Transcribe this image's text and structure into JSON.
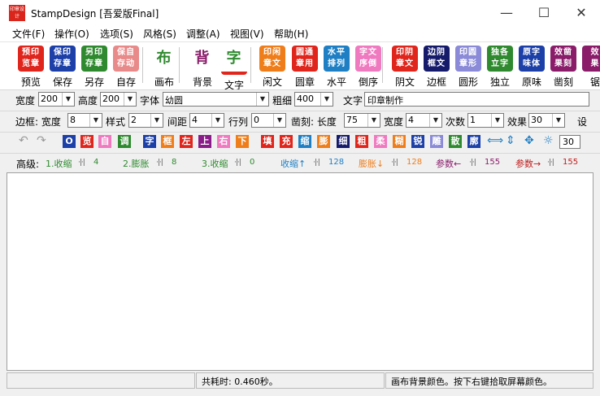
{
  "title": "StampDesign [吾爱版Final]",
  "app_icon_text": "印章设计",
  "window_controls": {
    "minimize": "—",
    "maximize": "☐",
    "close": "✕"
  },
  "menu": [
    "文件(F)",
    "操作(O)",
    "选项(S)",
    "风格(S)",
    "调整(A)",
    "视图(V)",
    "帮助(H)"
  ],
  "big_toolbar": [
    {
      "icon": [
        "预印",
        "览章"
      ],
      "label": "预览",
      "color": "#e0251c"
    },
    {
      "icon": [
        "保印",
        "存章"
      ],
      "label": "保存",
      "color": "#1c3fa8"
    },
    {
      "icon": [
        "另印",
        "存章"
      ],
      "label": "另存",
      "color": "#2f8a2f"
    },
    {
      "icon": [
        "保自",
        "存动"
      ],
      "label": "自存",
      "color": "#e98a8a"
    },
    {
      "icon": [
        "布"
      ],
      "label": "画布",
      "color": "#ffffff"
    },
    {
      "icon": [
        "背"
      ],
      "label": "背景",
      "color": "#ffffff"
    },
    {
      "icon": [
        "字"
      ],
      "label": "文字",
      "color": "#ffffff"
    },
    {
      "icon": [
        "印闲",
        "章文"
      ],
      "label": "闲文",
      "color": "#ef7d1a"
    },
    {
      "icon": [
        "圆通",
        "章用"
      ],
      "label": "圆章",
      "color": "#e0251c"
    },
    {
      "icon": [
        "水平",
        "排列"
      ],
      "label": "水平",
      "color": "#1f7fc4"
    },
    {
      "icon": [
        "字文",
        "序倒"
      ],
      "label": "倒序",
      "color": "#f07ac0"
    },
    {
      "icon": [
        "印阴",
        "章文"
      ],
      "label": "阴文",
      "color": "#e0251c"
    },
    {
      "icon": [
        "边阴",
        "框文"
      ],
      "label": "边框",
      "color": "#151a6a"
    },
    {
      "icon": [
        "印圆",
        "章形"
      ],
      "label": "圆形",
      "color": "#8a8ad8"
    },
    {
      "icon": [
        "独各",
        "立字"
      ],
      "label": "独立",
      "color": "#2f8a2f"
    },
    {
      "icon": [
        "原字",
        "味体"
      ],
      "label": "原味",
      "color": "#1c3fa8"
    },
    {
      "icon": [
        "效凿",
        "果刻"
      ],
      "label": "凿刻",
      "color": "#8a1c6a"
    },
    {
      "icon": [
        "效",
        "果"
      ],
      "label": "锯",
      "color": "#8a1c6a"
    }
  ],
  "font_row": {
    "width_label": "宽度",
    "width_value": "200",
    "height_label": "高度",
    "height_value": "200",
    "font_label": "字体",
    "font_value": "幼圆",
    "weight_label": "粗细",
    "weight_value": "400",
    "text_label": "文字",
    "text_value": "印章制作"
  },
  "border_row": {
    "border_label": "边框: 宽度",
    "border_width": "8",
    "style_label": "样式",
    "style_value": "2",
    "spacing_label": "间距",
    "spacing_value": "4",
    "row_label": "行列",
    "row_value": "0",
    "chisel_label": "凿刻: 长度",
    "chisel_length": "75",
    "chisel_width_label": "宽度",
    "chisel_width": "4",
    "count_label": "次数",
    "count_value": "1",
    "effect_label": "效果",
    "effect_value": "30",
    "settings_label": "设"
  },
  "small_toolbar": {
    "undo": "↶",
    "redo": "↷",
    "buttons": [
      {
        "text": "O",
        "color": "#1c3fa8"
      },
      {
        "text": "览",
        "color": "#e0251c"
      },
      {
        "text": "自",
        "color": "#f07ac0"
      },
      {
        "text": "调",
        "color": "#2f8a2f"
      },
      {
        "text": "字",
        "color": "#1c3fa8"
      },
      {
        "text": "框",
        "color": "#ef7d1a"
      },
      {
        "text": "左",
        "color": "#e0251c"
      },
      {
        "text": "上",
        "color": "#8a1c8a"
      },
      {
        "text": "右",
        "color": "#f07ac0"
      },
      {
        "text": "下",
        "color": "#ef7d1a"
      },
      {
        "text": "填",
        "color": "#e0251c"
      },
      {
        "text": "充",
        "color": "#e0251c"
      },
      {
        "text": "缩",
        "color": "#1f7fc4"
      },
      {
        "text": "膨",
        "color": "#ef7d1a"
      },
      {
        "text": "细",
        "color": "#151a6a"
      },
      {
        "text": "粗",
        "color": "#e0251c"
      },
      {
        "text": "柔",
        "color": "#f07ac0"
      },
      {
        "text": "糊",
        "color": "#ef7d1a"
      },
      {
        "text": "锐",
        "color": "#1c3fa8"
      },
      {
        "text": "雕",
        "color": "#8a8ad8"
      },
      {
        "text": "散",
        "color": "#2f8a2f"
      },
      {
        "text": "廓",
        "color": "#1c3fa8"
      }
    ],
    "arrows": [
      "⟺",
      "⇕",
      "✥",
      "☼"
    ],
    "value": "30"
  },
  "advanced_row": {
    "label": "高级:",
    "items": [
      {
        "text": "1.收缩",
        "value": "4",
        "color": "#2f8a2f"
      },
      {
        "text": "2.膨胀",
        "value": "8",
        "color": "#2f8a2f"
      },
      {
        "text": "3.收缩",
        "value": "0",
        "color": "#2f8a2f"
      },
      {
        "text": "收缩↑",
        "value": "128",
        "color": "#1f7fc4"
      },
      {
        "text": "膨胀↓",
        "value": "128",
        "color": "#ef7d1a"
      },
      {
        "text": "参数←",
        "value": "155",
        "color": "#8a1c6a"
      },
      {
        "text": "参数→",
        "value": "155",
        "color": "#c01c1c"
      }
    ]
  },
  "status": {
    "time": "共耗时: 0.460秒。",
    "hint": "画布背景颜色。按下右键拾取屏幕颜色。"
  }
}
